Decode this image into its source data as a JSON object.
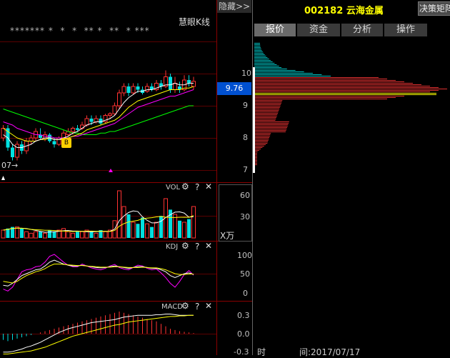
{
  "header": {
    "hide_button": "隐藏>>",
    "stock_code": "002182",
    "stock_name": "云海金属",
    "decision_button": "决策矩阵"
  },
  "tabs": [
    {
      "label": "报价",
      "active": true
    },
    {
      "label": "资金",
      "active": false
    },
    {
      "label": "分析",
      "active": false
    },
    {
      "label": "操作",
      "active": false
    }
  ],
  "main_chart": {
    "indicator_name": "慧眼K线",
    "stars": "******* *  *  *  ** *  **  * ***",
    "date_marker": "07→",
    "current_price": "9.76",
    "signal_badge": "B"
  },
  "price_axis": {
    "ticks": [
      "10",
      "9",
      "8",
      "7"
    ]
  },
  "volume": {
    "title": "VOL",
    "ticks": [
      "60",
      "30"
    ],
    "unit": "X万",
    "gear": "⚙",
    "help": "?",
    "close": "✕"
  },
  "kdj": {
    "title": "KDJ",
    "ticks": [
      "100",
      "50",
      "0"
    ],
    "gear": "⚙",
    "help": "?",
    "close": "✕"
  },
  "macd": {
    "title": "MACD",
    "ticks": [
      "0.3",
      "0.0",
      "-0.3"
    ],
    "gear": "⚙",
    "help": "?",
    "close": "✕"
  },
  "footer": {
    "time_label": "时",
    "date_text": "间:2017/07/17"
  },
  "colors": {
    "up": "#ff3232",
    "down": "#00e0e0",
    "ma_white": "#ffffff",
    "ma_yellow": "#ffff00",
    "ma_magenta": "#ff00ff",
    "ma_green": "#00ff00",
    "price_highlight": "#0050d0",
    "dist_cyan": "#00c0c0",
    "dist_red": "#e03030",
    "dist_yellow": "#ffff00",
    "stock_code_color": "#ffff00"
  }
}
